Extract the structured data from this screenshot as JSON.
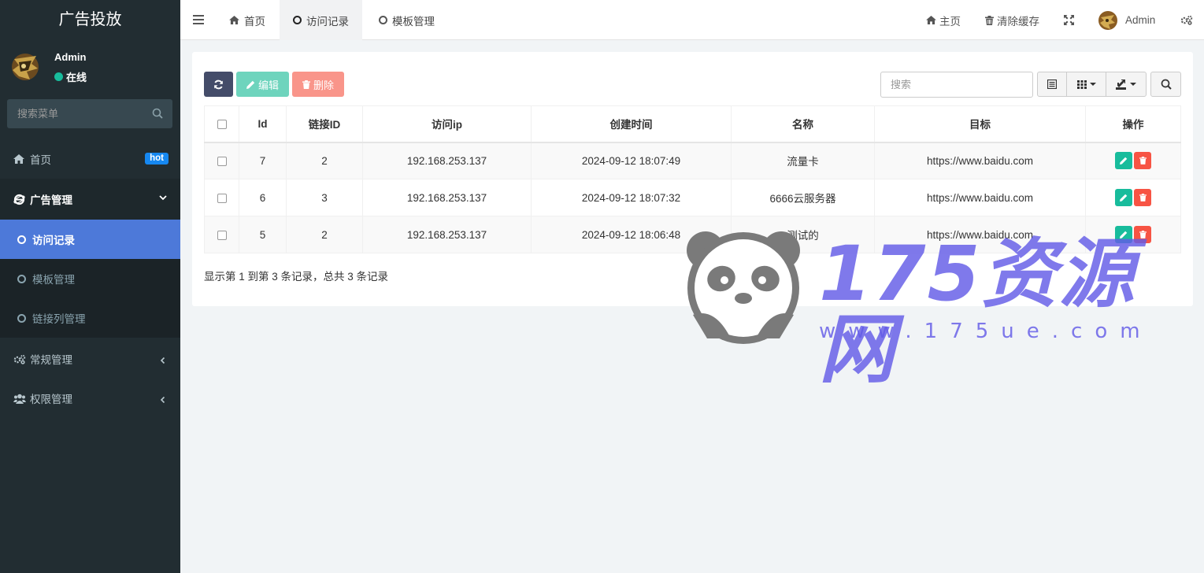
{
  "sidebar": {
    "title": "广告投放",
    "user": {
      "name": "Admin",
      "status": "在线"
    },
    "search_placeholder": "搜索菜单",
    "menu": {
      "home": {
        "label": "首页",
        "badge": "hot"
      },
      "ad": {
        "label": "广告管理",
        "children": [
          "访问记录",
          "模板管理",
          "链接列管理"
        ]
      },
      "general": {
        "label": "常规管理"
      },
      "auth": {
        "label": "权限管理"
      }
    }
  },
  "topbar": {
    "tabs": [
      "首页",
      "访问记录",
      "模板管理"
    ],
    "right": {
      "home": "主页",
      "clear_cache": "清除缓存",
      "user": "Admin"
    }
  },
  "toolbar": {
    "edit_label": "编辑",
    "delete_label": "删除",
    "search_placeholder": "搜索"
  },
  "table": {
    "headers": [
      "Id",
      "链接ID",
      "访问ip",
      "创建时间",
      "名称",
      "目标",
      "操作"
    ],
    "rows": [
      [
        "7",
        "2",
        "192.168.253.137",
        "2024-09-12 18:07:49",
        "流量卡",
        "https://www.baidu.com"
      ],
      [
        "6",
        "3",
        "192.168.253.137",
        "2024-09-12 18:07:32",
        "6666云服务器",
        "https://www.baidu.com"
      ],
      [
        "5",
        "2",
        "192.168.253.137",
        "2024-09-12 18:06:48",
        "测试的",
        "https://www.baidu.com"
      ]
    ]
  },
  "pagination": {
    "text": "显示第 1 到第 3 条记录，总共 3 条记录"
  },
  "watermark": {
    "brand": "175资源网",
    "url": "www.175ue.com"
  },
  "colors": {
    "sidebar_bg": "#222d32",
    "active_menu": "#4d79d9",
    "refresh_btn": "#444c69",
    "edit_btn": "#6ed4bd",
    "delete_btn": "#f9958a",
    "op_edit": "#18bc9c",
    "op_delete": "#f75444",
    "hot_badge": "#1688f1",
    "online_dot": "#18bc9c"
  }
}
